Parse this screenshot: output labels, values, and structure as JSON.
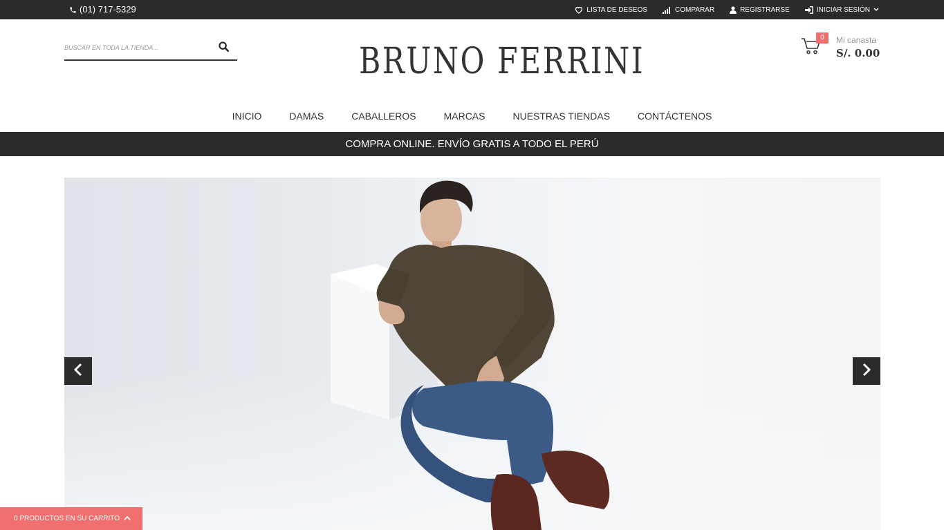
{
  "topbar": {
    "phone": "(01) 717-5329",
    "links": [
      {
        "label": "LISTA DE DESEOS",
        "icon": "heart-icon"
      },
      {
        "label": "COMPARAR",
        "icon": "signal-bars-icon"
      },
      {
        "label": "REGISTRARSE",
        "icon": "user-icon"
      },
      {
        "label": "INICIAR SESIÓN",
        "icon": "sign-in-icon"
      }
    ]
  },
  "search": {
    "placeholder": "BUSCAR EN TODA LA TIENDA...",
    "value": ""
  },
  "brand": {
    "logo_text": "BRUNO FERRINI"
  },
  "cart": {
    "count": "0",
    "label": "Mi canasta",
    "total": "S/. 0.00"
  },
  "nav": {
    "items": [
      "INICIO",
      "DAMAS",
      "CABALLEROS",
      "MARCAS",
      "NUESTRAS TIENDAS",
      "CONTÁCTENOS"
    ]
  },
  "promo": {
    "text": "COMPRA ONLINE. ENVÍO GRATIS A TODO EL PERÚ"
  },
  "mini_cart": {
    "text": "0 PRODUCTOS EN SU CARRITO"
  },
  "colors": {
    "dark": "#2b2b2b",
    "accent": "#f16f6f"
  }
}
